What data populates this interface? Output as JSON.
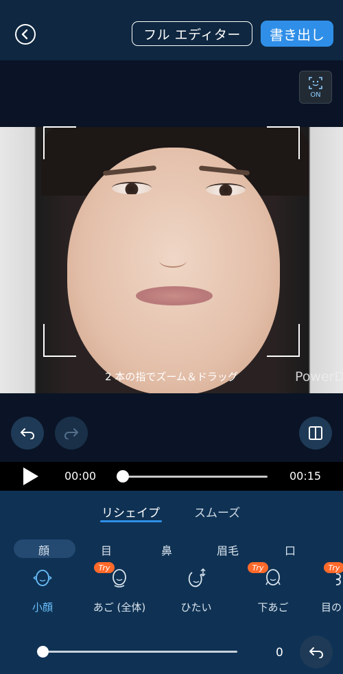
{
  "header": {
    "back_icon": "chevron-left-circle-icon",
    "full_editor_label": "フル エディター",
    "export_label": "書き出し"
  },
  "preview": {
    "face_detect_status": "ON",
    "hint_text": "2 本の指でズーム＆ドラッグ",
    "watermark": "PowerD"
  },
  "playback": {
    "current_time": "00:00",
    "total_time": "00:15",
    "progress": 0
  },
  "panel": {
    "tabs": [
      {
        "label": "リシェイプ",
        "active": true
      },
      {
        "label": "スムーズ",
        "active": false
      }
    ],
    "categories": [
      "顔",
      "目",
      "鼻",
      "眉毛",
      "口"
    ],
    "selected_category": "顔",
    "tools": [
      {
        "label": "小顔",
        "icon": "face-slim-icon",
        "try": false,
        "active": true
      },
      {
        "label": "あご (全体)",
        "icon": "chin-full-icon",
        "try": true,
        "active": false
      },
      {
        "label": "ひたい",
        "icon": "forehead-icon",
        "try": false,
        "active": false
      },
      {
        "label": "下あご",
        "icon": "jaw-icon",
        "try": true,
        "active": false
      },
      {
        "label": "目の",
        "icon": "eye-distance-icon",
        "try": true,
        "active": false
      }
    ],
    "try_badge_label": "Try",
    "slider_value": "0",
    "accent_color": "#2f8fe8",
    "try_color": "#ff6a2b"
  }
}
